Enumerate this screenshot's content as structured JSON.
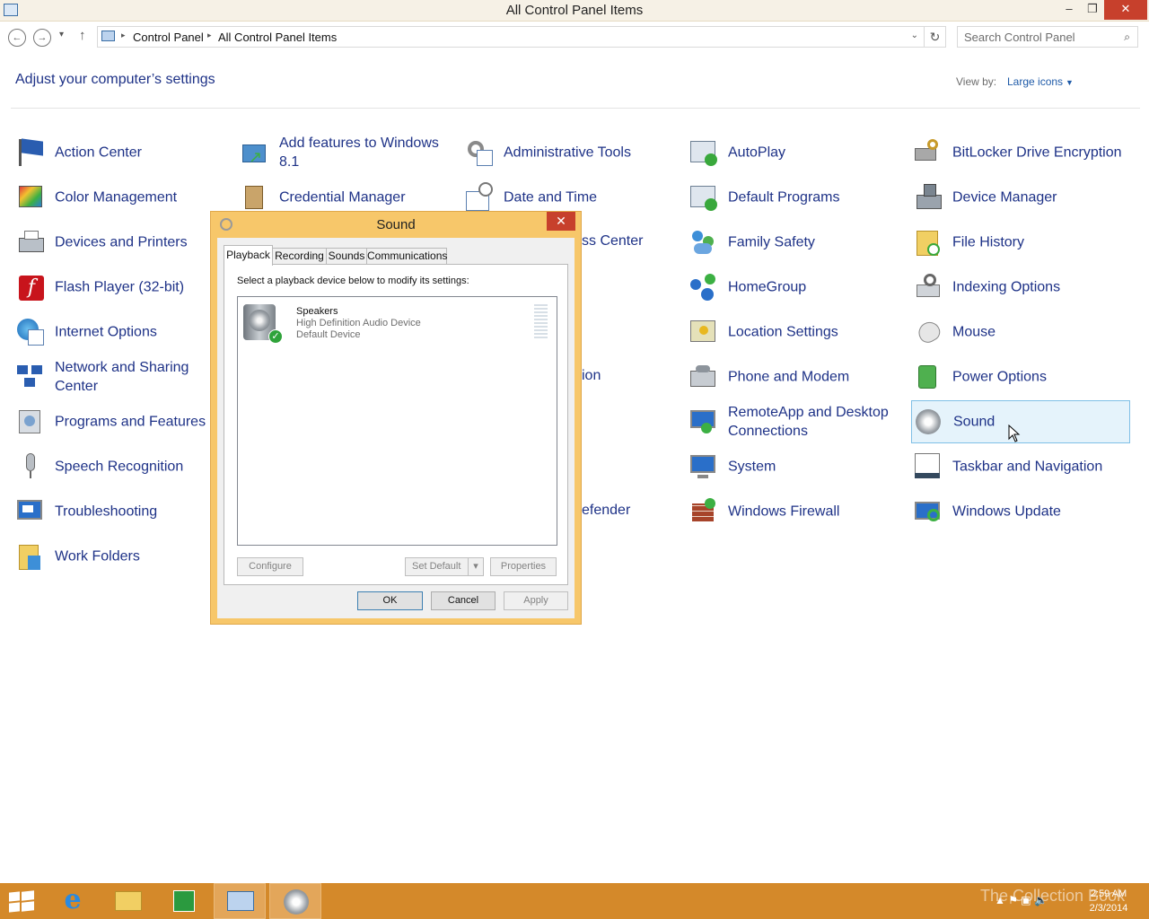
{
  "window": {
    "title": "All Control Panel Items",
    "minimize": "–",
    "maximize": "❐",
    "close": "✕"
  },
  "address": {
    "back": "←",
    "forward": "→",
    "recent": "▾",
    "up": "↑",
    "crumbs": [
      "Control Panel",
      "All Control Panel Items"
    ],
    "separator": "▸",
    "dropdown": "⌄",
    "refresh": "↻",
    "search_placeholder": "Search Control Panel",
    "search_icon": "⌕"
  },
  "header": {
    "title": "Adjust your computer’s settings",
    "view_by_label": "View by:",
    "view_by_value": "Large icons"
  },
  "items": [
    {
      "label": "Action Center",
      "icon": "flag-icon"
    },
    {
      "label": "Add features to Windows 8.1",
      "icon": "add-features-icon"
    },
    {
      "label": "Administrative Tools",
      "icon": "admin-tools-icon"
    },
    {
      "label": "AutoPlay",
      "icon": "autoplay-icon"
    },
    {
      "label": "BitLocker Drive Encryption",
      "icon": "bitlocker-icon"
    },
    {
      "label": "Color Management",
      "icon": "color-management-icon"
    },
    {
      "label": "Credential Manager",
      "icon": "credential-manager-icon"
    },
    {
      "label": "Date and Time",
      "icon": "calendar-clock-icon"
    },
    {
      "label": "Default Programs",
      "icon": "default-programs-icon"
    },
    {
      "label": "Device Manager",
      "icon": "device-manager-icon"
    },
    {
      "label": "Devices and Printers",
      "icon": "printer-icon"
    },
    {
      "label": "Ease of Access Center",
      "icon": "ease-of-access-icon"
    },
    {
      "label": "Family Safety",
      "icon": "family-safety-icon"
    },
    {
      "label": "File History",
      "icon": "file-history-icon"
    },
    {
      "label": "Flash Player (32-bit)",
      "icon": "flash-player-icon"
    },
    {
      "label": "HomeGroup",
      "icon": "homegroup-icon"
    },
    {
      "label": "Indexing Options",
      "icon": "indexing-icon"
    },
    {
      "label": "Internet Options",
      "icon": "internet-options-icon"
    },
    {
      "label": "Location Settings",
      "icon": "location-icon"
    },
    {
      "label": "Mouse",
      "icon": "mouse-icon"
    },
    {
      "label": "Network and Sharing Center",
      "icon": "network-icon"
    },
    {
      "label": "Personalization",
      "icon": "personalization-icon"
    },
    {
      "label": "Phone and Modem",
      "icon": "phone-icon"
    },
    {
      "label": "Power Options",
      "icon": "power-icon"
    },
    {
      "label": "Programs and Features",
      "icon": "programs-icon"
    },
    {
      "label": "RemoteApp and Desktop Connections",
      "icon": "remoteapp-icon"
    },
    {
      "label": "Sound",
      "icon": "speaker-icon"
    },
    {
      "label": "Speech Recognition",
      "icon": "microphone-icon"
    },
    {
      "label": "System",
      "icon": "system-icon"
    },
    {
      "label": "Taskbar and Navigation",
      "icon": "taskbar-icon"
    },
    {
      "label": "Troubleshooting",
      "icon": "troubleshooting-icon"
    },
    {
      "label": "Windows Defender",
      "icon": "defender-icon"
    },
    {
      "label": "Windows Firewall",
      "icon": "firewall-icon"
    },
    {
      "label": "Windows Update",
      "icon": "windows-update-icon"
    },
    {
      "label": "Work Folders",
      "icon": "work-folders-icon"
    }
  ],
  "partial_labels": {
    "ease": "ss Center",
    "personalization": "ion",
    "defender": "efender"
  },
  "dialog": {
    "title": "Sound",
    "close": "✕",
    "tabs": [
      "Playback",
      "Recording",
      "Sounds",
      "Communications"
    ],
    "instruction": "Select a playback device below to modify its settings:",
    "device": {
      "name": "Speakers",
      "description": "High Definition Audio Device",
      "status": "Default Device"
    },
    "buttons": {
      "configure": "Configure",
      "set_default": "Set Default",
      "set_default_arrow": "▾",
      "properties": "Properties",
      "ok": "OK",
      "cancel": "Cancel",
      "apply": "Apply"
    }
  },
  "taskbar": {
    "tray": "▲  ⚑  ▣  🔈",
    "time": "2:59 AM",
    "date": "2/3/2014",
    "watermark": "The Collection Book"
  },
  "colors": {
    "link": "#1e3287",
    "taskbar": "#d4892a",
    "dialog_frame": "#f7c76a",
    "selection": "#e5f3fb"
  }
}
